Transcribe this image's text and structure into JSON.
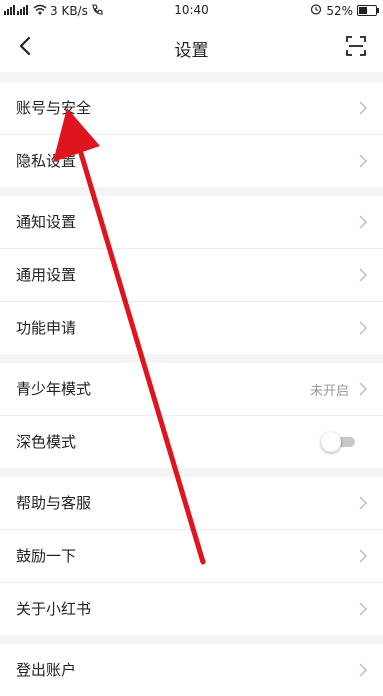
{
  "status_bar": {
    "signal_text": "4G",
    "speed": "3 KB/s",
    "time": "10:40",
    "battery": "52%"
  },
  "header": {
    "title": "设置",
    "back_icon": "back-arrow-icon",
    "scan_icon": "scan-icon"
  },
  "groups": [
    {
      "items": [
        {
          "label": "账号与安全"
        },
        {
          "label": "隐私设置"
        }
      ]
    },
    {
      "items": [
        {
          "label": "通知设置"
        },
        {
          "label": "通用设置"
        },
        {
          "label": "功能申请"
        }
      ]
    },
    {
      "items": [
        {
          "label": "青少年模式",
          "value": "未开启"
        },
        {
          "label": "深色模式",
          "toggle": "off"
        }
      ]
    },
    {
      "items": [
        {
          "label": "帮助与客服"
        },
        {
          "label": "鼓励一下"
        },
        {
          "label": "关于小红书"
        }
      ]
    },
    {
      "items": [
        {
          "label": "登出账户"
        }
      ]
    }
  ],
  "colors": {
    "accent_arrow": "#e0141e",
    "background": "#f4f4f4"
  }
}
